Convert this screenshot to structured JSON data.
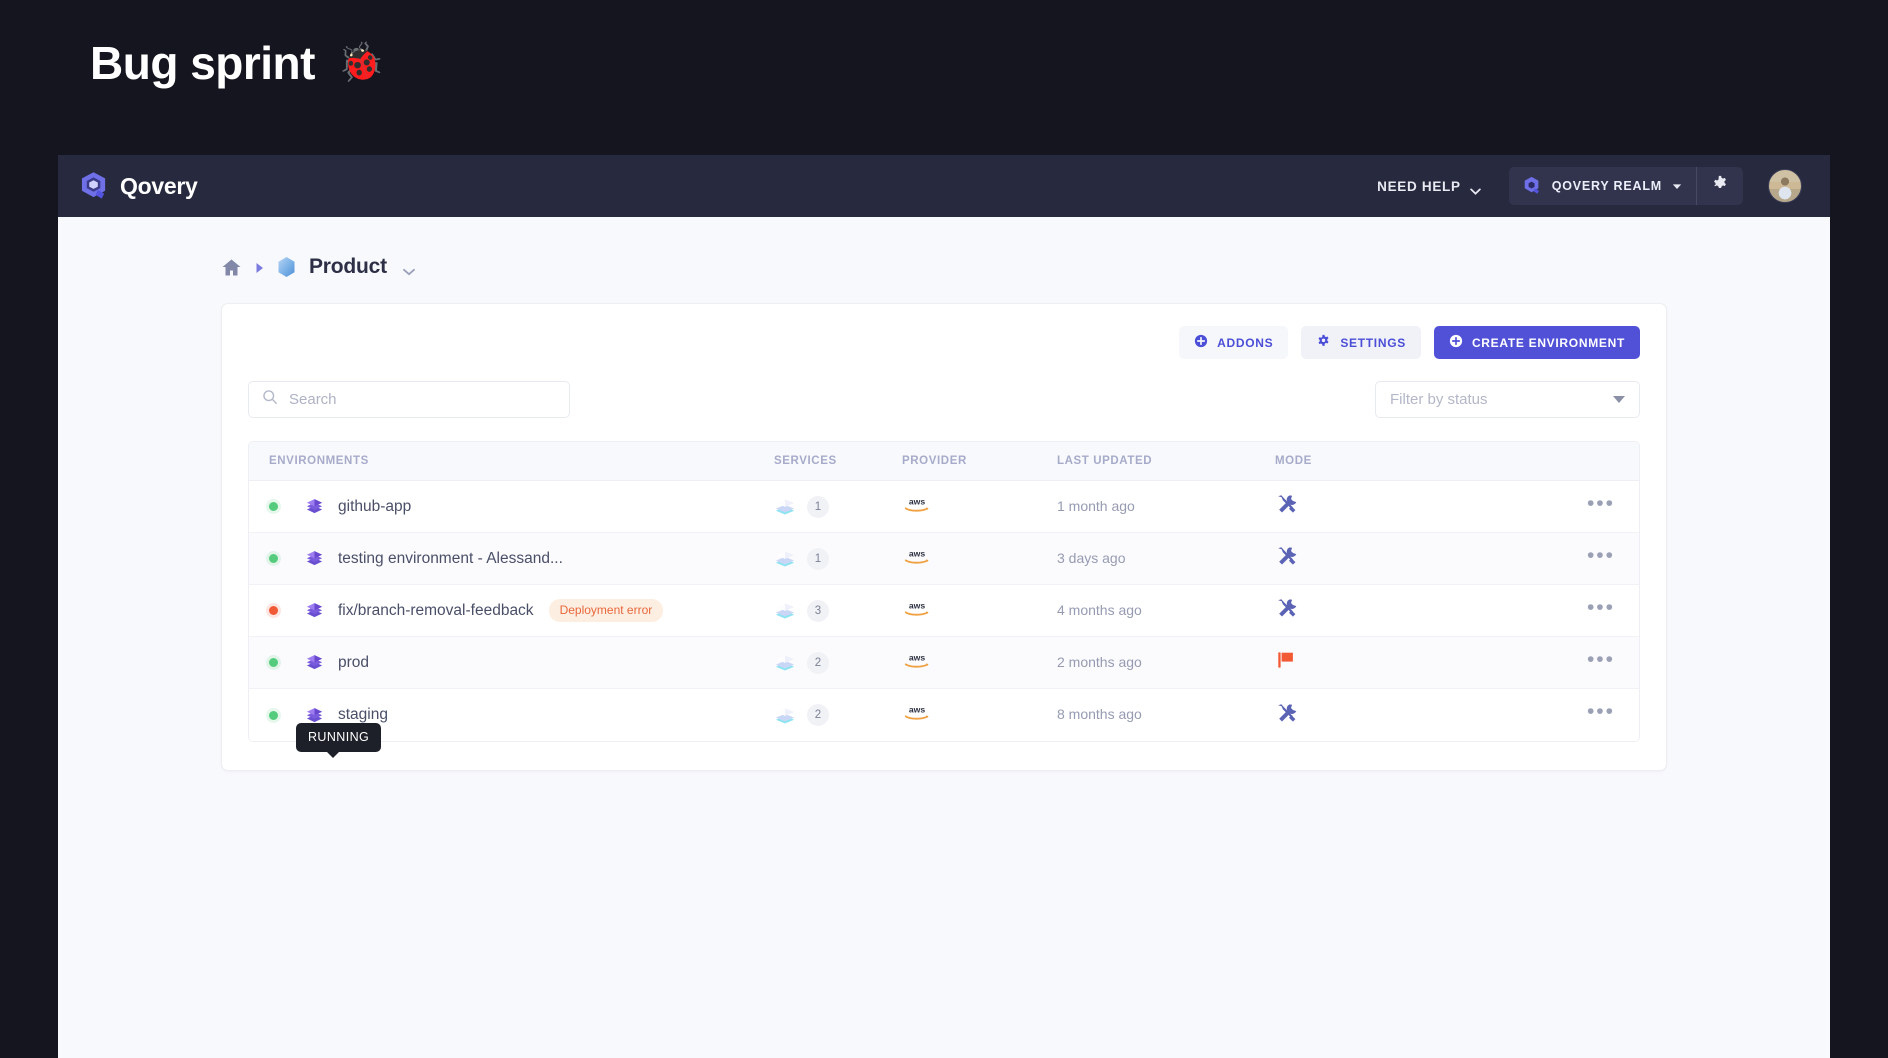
{
  "slide": {
    "title": "Bug sprint",
    "emoji": "🐞"
  },
  "topbar": {
    "brand": "Qovery",
    "need_help": "NEED HELP",
    "realm": "QOVERY REALM",
    "icons": {
      "logo": "qovery-logo-icon",
      "chevron": "chevron-down-icon",
      "realm": "qovery-realm-icon",
      "gear": "gear-icon",
      "avatar": "user-avatar"
    }
  },
  "breadcrumb": {
    "home": "home-icon",
    "separator": "caret-right-icon",
    "project_icon": "project-hexagon-icon",
    "project": "Product",
    "chevron": "chevron-down-icon"
  },
  "toolbar": {
    "addons_label": "ADDONS",
    "settings_label": "SETTINGS",
    "create_label": "CREATE ENVIRONMENT",
    "addons_icon": "plus-circle-icon",
    "settings_icon": "gear-icon",
    "create_icon": "plus-circle-icon",
    "accent_color": "#5151d8"
  },
  "search": {
    "value": "",
    "placeholder": "Search",
    "icon": "search-icon"
  },
  "status_filter": {
    "label": "Filter by status",
    "icon": "triangle-down-icon"
  },
  "table": {
    "headers": {
      "environments": "ENVIRONMENTS",
      "services": "SERVICES",
      "provider": "PROVIDER",
      "last_updated": "LAST UPDATED",
      "mode": "MODE"
    },
    "rows": [
      {
        "status": "green",
        "name": "github-app",
        "badge": "",
        "services": "1",
        "provider": "aws",
        "last_updated": "1 month ago",
        "mode": "tools-icon",
        "menu": "•••"
      },
      {
        "status": "green",
        "name": "testing environment - Alessand...",
        "badge": "",
        "services": "1",
        "provider": "aws",
        "last_updated": "3 days ago",
        "mode": "tools-icon",
        "menu": "•••"
      },
      {
        "status": "red",
        "name": "fix/branch-removal-feedback",
        "badge": "Deployment error",
        "services": "3",
        "provider": "aws",
        "last_updated": "4 months ago",
        "mode": "tools-icon",
        "menu": "•••"
      },
      {
        "status": "green",
        "name": "prod",
        "badge": "",
        "services": "2",
        "provider": "aws",
        "last_updated": "2 months ago",
        "mode": "flag-icon",
        "menu": "•••"
      },
      {
        "status": "green",
        "name": "staging",
        "badge": "",
        "services": "2",
        "provider": "aws",
        "last_updated": "8 months ago",
        "mode": "tools-icon",
        "menu": "•••"
      }
    ]
  },
  "tooltip": {
    "text": "RUNNING"
  },
  "colors": {
    "page_bg": "#15151f",
    "app_bg": "#f8f9fc",
    "topbar_bg": "#272a3f",
    "accent": "#5151d8",
    "status_ok": "#55cc7d",
    "status_error": "#f05a37",
    "badge_bg": "#fdeee2",
    "badge_text": "#e8673a"
  }
}
